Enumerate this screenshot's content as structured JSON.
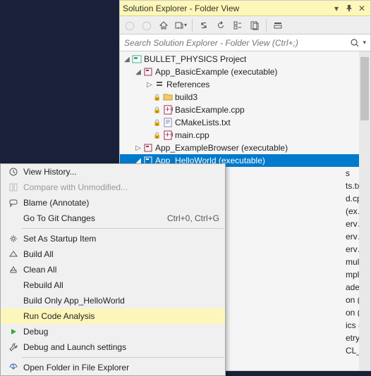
{
  "titlebar": {
    "title": "Solution Explorer - Folder View"
  },
  "searchbar": {
    "placeholder": "Search Solution Explorer - Folder View (Ctrl+;)"
  },
  "tree": {
    "project": "BULLET_PHYSICS Project",
    "nodes": {
      "app_basic": "App_BasicExample (executable)",
      "references": "References",
      "build3": "build3",
      "basicexample": "BasicExample.cpp",
      "cmakelists": "CMakeLists.txt",
      "main": "main.cpp",
      "app_examplebrowser": "App_ExampleBrowser (executable)",
      "app_helloworld": "App_HelloWorld (executable)",
      "partial1": "s",
      "partial2": "ts.txt",
      "partial3": "d.cpp",
      "partial4": "(executable)",
      "partial5": "erver_SharedMemory (executable)",
      "partial6": "erver_SharedMemory_GUI (executa",
      "partial7": "erver_SharedMemory_VR (executab",
      "partial8": "mulator (executable)",
      "partial9": "mpleGui (executable)",
      "partial10": "ader (static library)",
      "partial11": "on (static library)",
      "partial12": "on (static library)",
      "partial13": "ics (static library)",
      "partial14": "etry (static library)",
      "partial15": "CL_clew (static library)"
    }
  },
  "context_menu": {
    "view_history": "View History...",
    "compare": "Compare with Unmodified...",
    "blame": "Blame (Annotate)",
    "go_git": "Go To Git Changes",
    "go_git_accel": "Ctrl+0, Ctrl+G",
    "set_startup": "Set As Startup Item",
    "build_all": "Build All",
    "clean_all": "Clean All",
    "rebuild_all": "Rebuild All",
    "build_only": "Build Only App_HelloWorld",
    "run_analysis": "Run Code Analysis",
    "debug": "Debug",
    "debug_settings": "Debug and Launch settings",
    "open_folder": "Open Folder in File Explorer"
  },
  "colors": {
    "accent": "#007acc",
    "titlebar_bg": "#fdf7b8"
  }
}
